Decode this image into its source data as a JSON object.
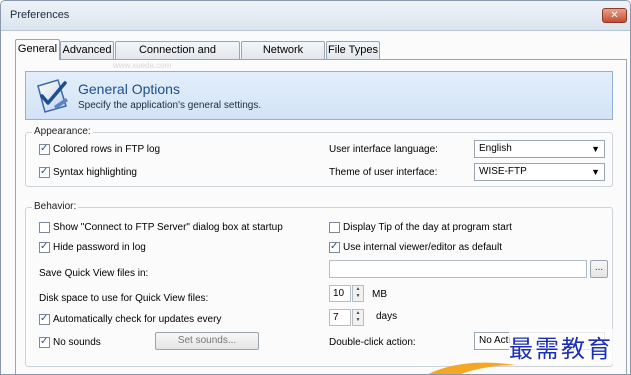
{
  "window": {
    "title": "Preferences",
    "close_glyph": "✕"
  },
  "tabs": [
    {
      "label": "General",
      "active": true
    },
    {
      "label": "Advanced",
      "active": false
    },
    {
      "label": "Connection and Transfers",
      "active": false
    },
    {
      "label": "Network Settings",
      "active": false
    },
    {
      "label": "File Types",
      "active": false
    }
  ],
  "header": {
    "title": "General Options",
    "subtitle": "Specify the application's general settings.",
    "icon": "checklist-icon",
    "faint_text": "www.xueda.com"
  },
  "appearance": {
    "label": "Appearance:",
    "colored_rows": {
      "label": "Colored rows in FTP log",
      "checked": true
    },
    "syntax_highlighting": {
      "label": "Syntax highlighting",
      "checked": true
    },
    "language_label": "User interface language:",
    "language_value": "English",
    "theme_label": "Theme of user interface:",
    "theme_value": "WISE-FTP"
  },
  "behavior": {
    "label": "Behavior:",
    "show_connect_dialog": {
      "label": "Show \"Connect to FTP Server\" dialog box at startup",
      "checked": false
    },
    "display_tip": {
      "label": "Display Tip of the day at program start",
      "checked": false
    },
    "hide_password": {
      "label": "Hide password in log",
      "checked": true
    },
    "internal_viewer": {
      "label": "Use internal viewer/editor as default",
      "checked": true
    },
    "save_quick_view_label": "Save Quick View files in:",
    "save_quick_view_value": "",
    "browse_label": "...",
    "disk_space_label": "Disk space to use for Quick View files:",
    "disk_space_value": "10",
    "disk_space_unit": "MB",
    "auto_update": {
      "label": "Automatically check for updates every",
      "checked": true
    },
    "auto_update_value": "7",
    "auto_update_unit": "days",
    "no_sounds": {
      "label": "No sounds",
      "checked": true
    },
    "set_sounds_label": "Set sounds...",
    "double_click_label": "Double-click action:",
    "double_click_value": "No Acti"
  },
  "watermark": {
    "text": "最需教育"
  },
  "colors": {
    "accent": "#1f4e8c",
    "header_bg": "#d3e3f5",
    "watermark": "#1d2fb2",
    "swoosh": "#f5a623"
  }
}
